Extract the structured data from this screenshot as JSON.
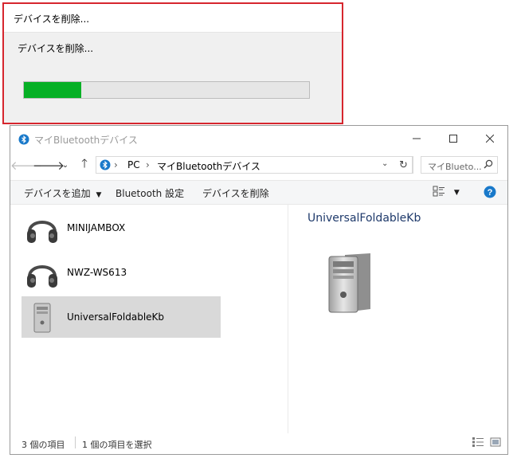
{
  "progress_dialog": {
    "title": "デバイスを削除...",
    "message": "デバイスを削除...",
    "progress_percent": 20,
    "bar_color": "#06b025",
    "border_color": "#d6262e"
  },
  "explorer": {
    "title": "マイBluetoothデバイス",
    "address": {
      "crumbs": [
        "PC",
        "マイBluetoothデバイス"
      ]
    },
    "search": {
      "placeholder": "マイBlueto..."
    },
    "toolbar": {
      "add_device": "デバイスを追加",
      "bluetooth_settings": "Bluetooth 設定",
      "remove_device": "デバイスを削除"
    },
    "devices": [
      {
        "name": "MINIJAMBOX",
        "icon": "headphones-icon",
        "selected": false
      },
      {
        "name": "NWZ-WS613",
        "icon": "headphones-icon",
        "selected": false
      },
      {
        "name": "UniversalFoldableKb",
        "icon": "computer-tower-icon",
        "selected": true
      }
    ],
    "details": {
      "title": "UniversalFoldableKb",
      "icon": "computer-tower-icon"
    },
    "status": {
      "item_count": "3 個の項目",
      "selected_count": "1 個の項目を選択"
    },
    "accent_color": "#1979ca"
  }
}
